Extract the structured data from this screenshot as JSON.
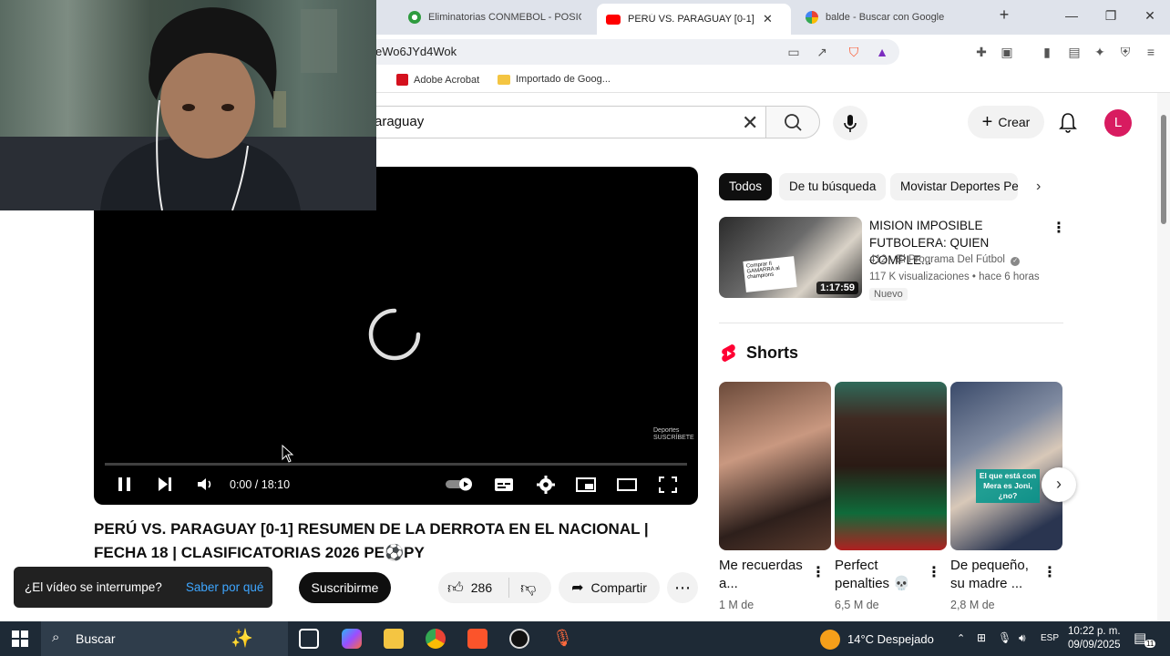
{
  "browser": {
    "tabs": [
      {
        "title": "Eliminatorias CONMEBOL - POSIC",
        "icon": "globe-green-icon"
      },
      {
        "title": "PERÚ VS. PARAGUAY [0-1] RE",
        "icon": "youtube-icon",
        "active": true
      },
      {
        "title": "balde - Buscar con Google",
        "icon": "google-icon"
      }
    ],
    "url": "eWo6JYd4Wok",
    "bookmarks": [
      {
        "label": "Adobe Acrobat",
        "icon": "pdf-icon"
      },
      {
        "label": "Importado de Goog...",
        "icon": "folder-icon"
      }
    ]
  },
  "youtube": {
    "search_value": "araguay",
    "create_label": "Crear",
    "avatar_letter": "L"
  },
  "player": {
    "time": "0:00 / 18:10",
    "watermark_line1": "Deportes",
    "watermark_line2": "SUSCRÍBETE"
  },
  "video": {
    "title": "PERÚ VS. PARAGUAY [0-1] RESUMEN DE LA DERROTA EN EL NACIONAL | FECHA 18 | CLASIFICATORIAS 2026 PE⚽PY",
    "subscribe_label": "Suscribirme",
    "likes": "286",
    "share_label": "Compartir"
  },
  "toast": {
    "message": "¿El vídeo se interrumpe?",
    "link": "Saber por qué"
  },
  "chips": [
    "Todos",
    "De tu búsqueda",
    "Movistar Deportes Pe"
  ],
  "recommended": {
    "title": "MISION IMPOSIBLE FUTBOLERA: QUIEN COMPLE...",
    "channel": "412 - El Programa Del Fútbol",
    "stats": "117 K visualizaciones • hace 6 horas",
    "badge": "Nuevo",
    "duration": "1:17:59",
    "thumb_caption": "Comprar Il GAMARRA al champions"
  },
  "shorts": {
    "label": "Shorts",
    "items": [
      {
        "title": "Me recuerdas a...",
        "views": "1 M de",
        "caption": ""
      },
      {
        "title": "Perfect penalties 💀",
        "views": "6,5 M de",
        "caption": ""
      },
      {
        "title": "De pequeño, su madre ...",
        "views": "2,8 M de",
        "caption": "El que está con Mera es Joni, ¿no?"
      }
    ]
  },
  "taskbar": {
    "search": "Buscar",
    "weather": "14°C  Despejado",
    "lang": "ESP",
    "time": "10:22 p. m.",
    "date": "09/09/2025",
    "notif_count": "11"
  }
}
